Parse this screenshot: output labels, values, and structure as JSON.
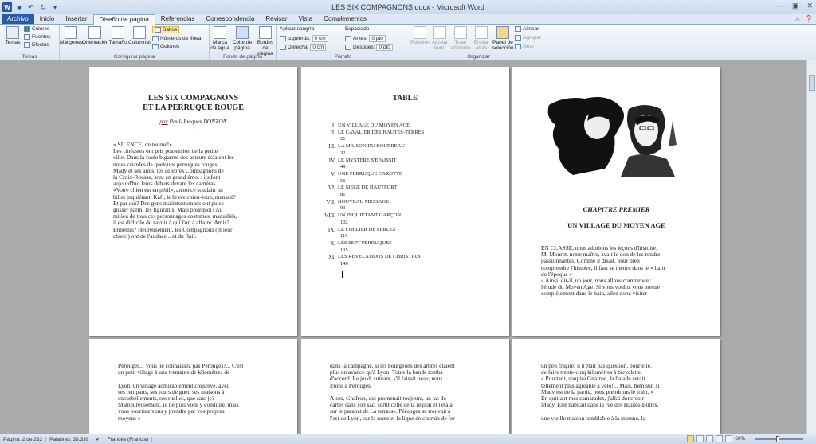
{
  "window": {
    "title": "LES SIX COMPAGNONS.docx - Microsoft Word"
  },
  "tabs": [
    "Archivo",
    "Inicio",
    "Insertar",
    "Diseño de página",
    "Referencias",
    "Correspondencia",
    "Revisar",
    "Vista",
    "Complementos"
  ],
  "ribbon": {
    "temas": {
      "button": "Temas",
      "colores": "Colores",
      "fuentes": "Fuentes",
      "efectos": "Efectos",
      "label": "Temas"
    },
    "config": {
      "margenes": "Márgenes",
      "orientacion": "Orientación",
      "tamano": "Tamaño",
      "columnas": "Columnas",
      "saltos": "Saltos",
      "numeros": "Números de línea",
      "guiones": "Guiones",
      "label": "Configurar página"
    },
    "fondo": {
      "marca": "Marca de agua",
      "color": "Color de página",
      "bordes": "Bordes de página",
      "label": "Fondo de página"
    },
    "parrafo": {
      "sangria": "Aplicar sangría",
      "izquierda": "Izquierda:",
      "izq_val": "0 cm",
      "derecha": "Derecha:",
      "der_val": "0 cm",
      "espaciado": "Espaciado",
      "antes": "Antes:",
      "antes_val": "0 pto",
      "despues": "Después:",
      "despues_val": "0 pto",
      "label": "Párrafo"
    },
    "organizar": {
      "posicion": "Posición",
      "ajustar": "Ajustar texto",
      "traer": "Traer adelante",
      "enviar": "Enviar atrás",
      "panel": "Panel de selección",
      "alinear": "Alinear",
      "agrupar": "Agrupar",
      "girar": "Girar",
      "label": "Organizar"
    }
  },
  "page1": {
    "title1": "LES SIX COMPAGNONS",
    "title2": "ET LA PERRUQUE ROUGE",
    "author_prefix": "par",
    "author": "Paul-Jacques BONZON",
    "dot": "-",
    "lines": [
      "« SILENCE, on tourne!»",
      "Les cinéastes ont pris possession de la petite",
      "ville. Dans la foule bigarrée des acteurs éclatent les",
      "notes criardes de quelques perruques rouges...",
      "Mady et ses amis, les célèbres Compagnons de",
      "la Croix-Rousse, sont en grand émoi : ils font",
      "aujourd'hui leurs débuts devant les caméras.",
      "«Votre chien est en péril», annonce soudain un",
      "billet inquiétant. Kafi, le brave chien-loup, menacé?",
      "Et par qui? Des gens malintentionnés ont pu se",
      "glisser parmi les figurants. Mais pourquoi? Au",
      "milieu de tous ces personnages costumés, maquillés,",
      "il est difficile de savoir à qui l'on a affaire. Amis?",
      "Ennemis? Heureusement, les Compagnons (et leur",
      "chien!) ont de l'audace... et du flair."
    ]
  },
  "page2": {
    "title": "TABLE",
    "entries": [
      {
        "num": "I.",
        "title": "UN VILLAGE DU MOYEN AGE",
        "page": ""
      },
      {
        "num": "II.",
        "title": "LE CAVALIER DES HAUTES-TERRES",
        "page": "21"
      },
      {
        "num": "III.",
        "title": "LA MAISON DU BOURREAU",
        "page": "32"
      },
      {
        "num": "IV.",
        "title": "LE MYSTERE S'EPAISSIT",
        "page": "49"
      },
      {
        "num": "V.",
        "title": "UNE PERRUQUE CAROTTE",
        "page": "66"
      },
      {
        "num": "VI.",
        "title": "LE SIEGE DE HAUTFORT",
        "page": "81"
      },
      {
        "num": "VII.",
        "title": "NOUVEAU MESSAGE",
        "page": "93"
      },
      {
        "num": "VIII.",
        "title": "UN INQUIETANT GARÇON",
        "page": "102"
      },
      {
        "num": "IX.",
        "title": "LE COLLIER DE PERLES",
        "page": "115"
      },
      {
        "num": "X.",
        "title": "LES SEPT PERRUQUES",
        "page": "135"
      },
      {
        "num": "XI.",
        "title": "LES REVELATIONS DE CHRISTIAN",
        "page": "146"
      }
    ]
  },
  "page3": {
    "chapter": "CHAPITRE PREMIER",
    "chapter_title": "UN VILLAGE DU MOYEN AGE",
    "lines": [
      "EN CLASSE, nous adorions les leçons d'histoire.",
      "M. Mouret, notre maître, avait le don de les rendre",
      "passionnantes.    Comme    il    disait,    pour    bien",
      "comprendre l'histoire, il faut se mettre dans le « bain",
      "de l'époque »",
      "« Ainsi, dit-il, un jour, nous allons commencer",
      "l'étude du Moyen Age. Si vous voulez vous mettre",
      "complètement    dans    le    bain,    allez    donc    visiter"
    ]
  },
  "page4": {
    "lines": [
      "Pérouges... Vous ne connaissez pas Pérouges?... C'est",
      "un petit village à une trentaine de kilomètres de",
      "",
      "Lyon, un village admirablement conservé, avec",
      "ses remparts, ses tours de guet, ses maisons à",
      "encorbellements,    ses    ruelles,    que    sais-je?",
      "Malheureusement, je ne puis vous y conduire, mais",
      "vous pourriez vous y prendre par vos propres",
      "moyens »"
    ]
  },
  "page5": {
    "lines": [
      "dans la campagne, si les bourgeons des arbres étaient",
      "plus en avance qu'à Lyon. Toute la bande tomba",
      "d'accord. Le jeudi suivant, s'il faisait beau, nous",
      "irions à Pérouges.",
      "",
      "Alors, Gnafron, qui promenait toujours, un tas de",
      "cartes dans son sac, sortit celle de la région et l'étala",
      "sur le parapet de La terrasse. Pérouges se trouvait à",
      "l'est de Lyon, sur la route et la ligne de chemin de fer"
    ]
  },
  "page6": {
    "lines": [
      "un peu fragile; il n'était pas question, pour elle,",
      "de faire trente-cinq kilomètres à bicyclette.",
      "« Pourtant, soupira Gnafron, la balade serait",
      "tellement plus agréable à vélo!... Mais, bien sûr, si",
      "Mady est de la partie, nous prendrons le train. »",
      "En quittant mes camarades, j'allai donc voir",
      "Mady. Elle habitait dans la rue des Hautes-Buttes.",
      "",
      "une vieille maison semblable à la mienne, la"
    ]
  },
  "status": {
    "page": "Página: 2 de 232",
    "words": "Palabras: 39.339",
    "lang": "Francés (Francia)",
    "zoom": "60%"
  }
}
